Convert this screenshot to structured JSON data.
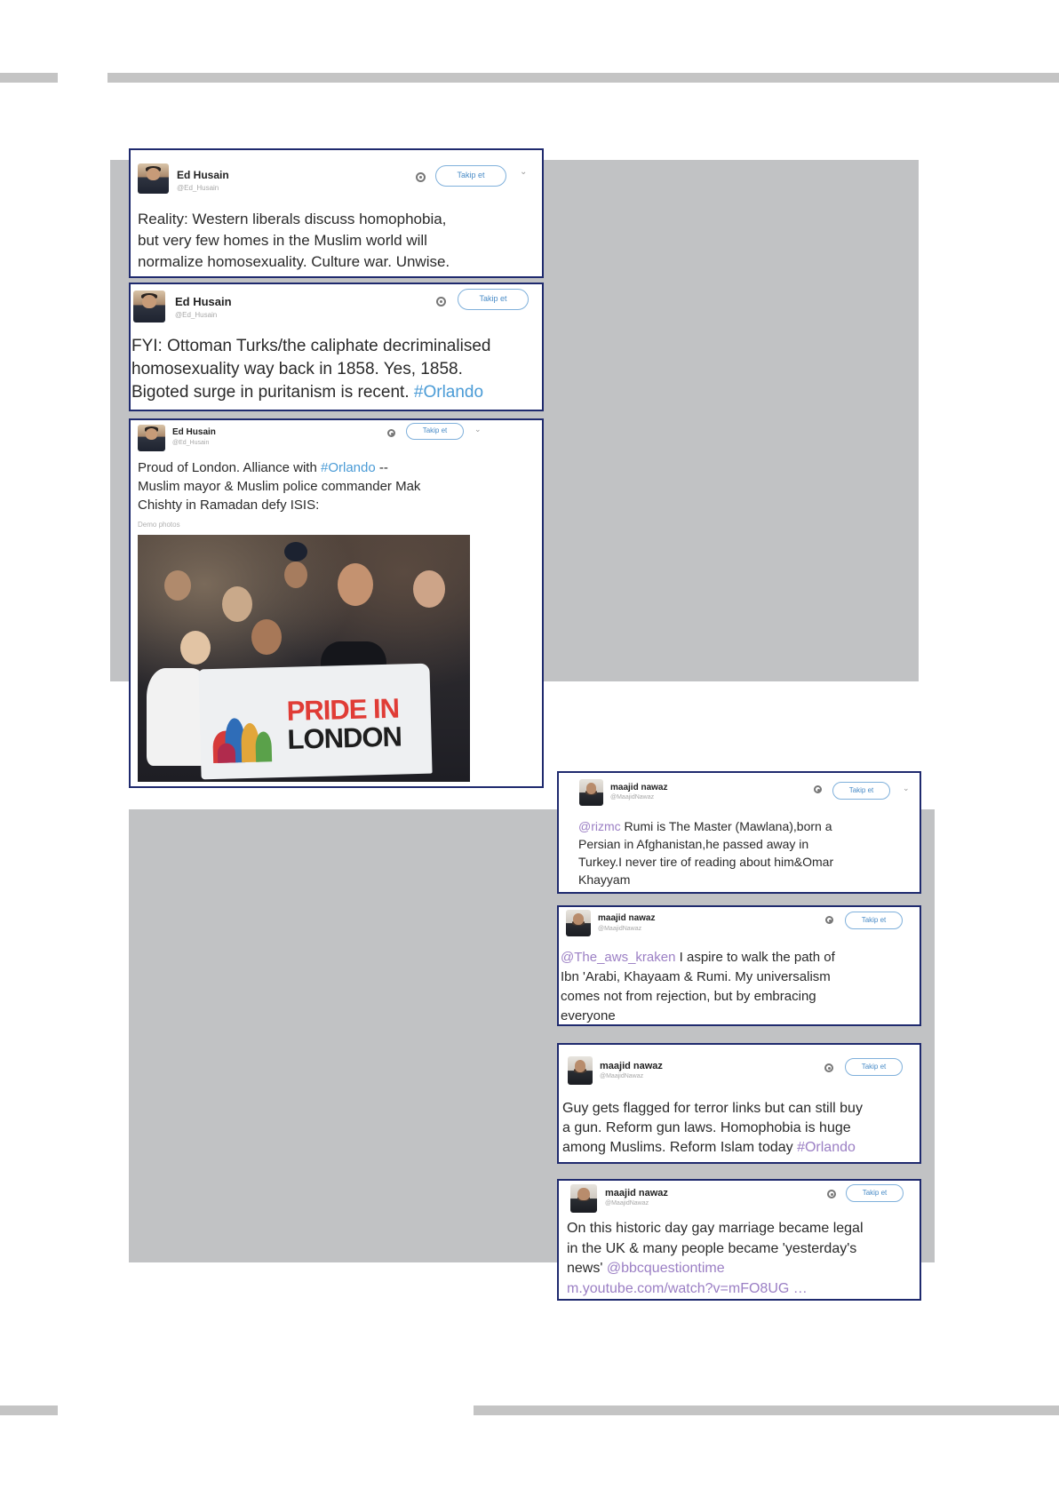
{
  "tweets": [
    {
      "name": "Ed Husain",
      "handle": "@Ed_Husain",
      "follow_label": "Takip et",
      "lines": [
        [
          {
            "t": "Reality: Western liberals discuss homophobia,"
          }
        ],
        [
          {
            "t": "but very few homes in the Muslim world will"
          }
        ],
        [
          {
            "t": "normalize homosexuality. Culture war. Unwise."
          }
        ]
      ]
    },
    {
      "name": "Ed Husain",
      "handle": "@Ed_Husain",
      "follow_label": "Takip et",
      "lines": [
        [
          {
            "t": "FYI: Ottoman Turks/the caliphate decriminalised"
          }
        ],
        [
          {
            "t": "homosexuality way back in 1858. Yes, 1858."
          }
        ],
        [
          {
            "t": "Bigoted surge in puritanism is recent. "
          },
          {
            "t": "#Orlando",
            "c": "link"
          }
        ]
      ]
    },
    {
      "name": "Ed Husain",
      "handle": "@Ed_Husain",
      "follow_label": "Takip et",
      "lines": [
        [
          {
            "t": "Proud of London. Alliance with "
          },
          {
            "t": "#Orlando",
            "c": "link"
          },
          {
            "t": " --"
          }
        ],
        [
          {
            "t": "Muslim mayor & Muslim police commander Mak"
          }
        ],
        [
          {
            "t": "Chishty in Ramadan defy ISIS:"
          }
        ]
      ],
      "photo_meta": "Demo photos",
      "banner": {
        "line1": "PRIDE IN",
        "line2": "LONDON"
      }
    },
    {
      "name": "maajid nawaz",
      "handle": "@MaajidNawaz",
      "follow_label": "Takip et",
      "lines": [
        [
          {
            "t": "@rizmc",
            "c": "mention"
          },
          {
            "t": " Rumi is The Master (Mawlana),born a"
          }
        ],
        [
          {
            "t": "Persian in Afghanistan,he passed away in"
          }
        ],
        [
          {
            "t": "Turkey.I never tire of reading about him&Omar"
          }
        ],
        [
          {
            "t": "Khayyam"
          }
        ]
      ]
    },
    {
      "name": "maajid nawaz",
      "handle": "@MaajidNawaz",
      "follow_label": "Takip et",
      "lines": [
        [
          {
            "t": "@The_aws_kraken",
            "c": "mention"
          },
          {
            "t": " I aspire to walk the path of"
          }
        ],
        [
          {
            "t": "Ibn 'Arabi, Khayaam & Rumi. My universalism"
          }
        ],
        [
          {
            "t": "comes not from rejection, but by embracing"
          }
        ],
        [
          {
            "t": "everyone"
          }
        ]
      ]
    },
    {
      "name": "maajid nawaz",
      "handle": "@MaajidNawaz",
      "follow_label": "Takip et",
      "lines": [
        [
          {
            "t": "Guy gets flagged for terror links but can still buy"
          }
        ],
        [
          {
            "t": "a gun. Reform gun laws. Homophobia is huge"
          }
        ],
        [
          {
            "t": "among Muslims. Reform Islam today "
          },
          {
            "t": "#Orlando",
            "c": "mention"
          }
        ]
      ]
    },
    {
      "name": "maajid nawaz",
      "handle": "@MaajidNawaz",
      "follow_label": "Takip et",
      "lines": [
        [
          {
            "t": "On this historic day gay marriage became legal"
          }
        ],
        [
          {
            "t": "in the UK & many people became 'yesterday's"
          }
        ],
        [
          {
            "t": "news' "
          },
          {
            "t": "@bbcquestiontime",
            "c": "mention"
          }
        ],
        [
          {
            "t": "m.youtube.com/watch?v=mFO8UG",
            "c": "mention"
          },
          {
            "t": " …",
            "c": "mention"
          }
        ]
      ]
    }
  ],
  "colors": {
    "frame_border": "#1f2a6e",
    "panel_gray": "#c1c2c4",
    "rule_gray": "#c4c4c4",
    "hashtag_blue": "#4a9bd6",
    "mention_purple": "#9b7fc4"
  }
}
